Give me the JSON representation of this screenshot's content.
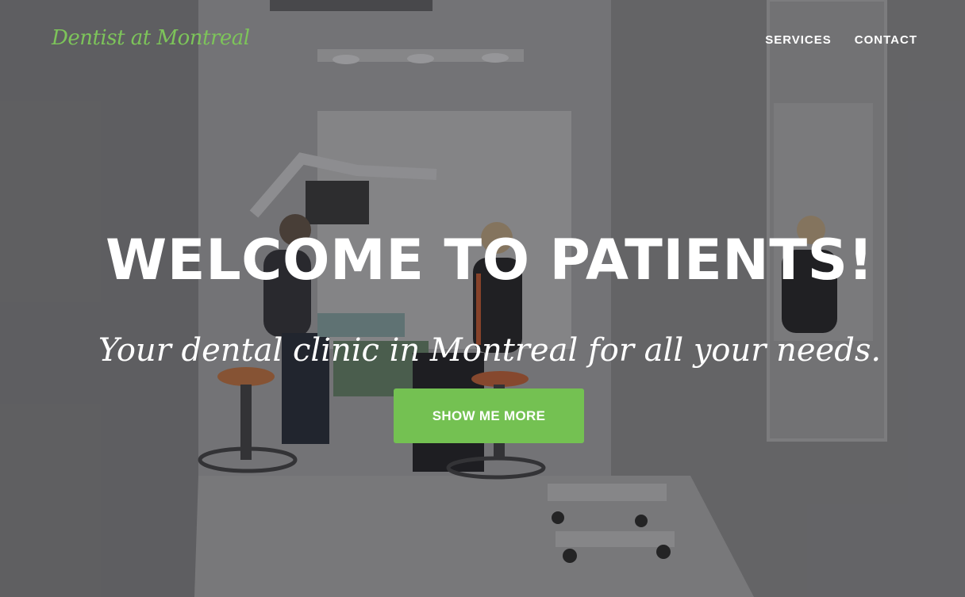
{
  "brand": {
    "name": "Dentist at Montreal"
  },
  "nav": {
    "items": [
      {
        "label": "SERVICES"
      },
      {
        "label": "CONTACT"
      }
    ]
  },
  "hero": {
    "headline": "WELCOME TO PATIENTS!",
    "subheadline": "Your dental clinic in Montreal for all your needs.",
    "cta_label": "SHOW ME MORE",
    "background": "dental-clinic-photo"
  },
  "colors": {
    "brand_green": "#7dc45a",
    "button_green": "#74c152",
    "text": "#ffffff"
  }
}
